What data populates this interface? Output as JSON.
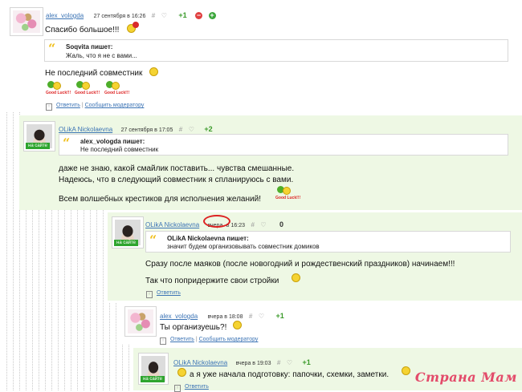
{
  "comments": [
    {
      "user": "alex_vologda",
      "date": "27 сентября в 16:26",
      "hash": "#",
      "score": "+1",
      "minus": "−",
      "plus": "+",
      "text": "Спасибо большое!!!",
      "quote": {
        "name": "Soqvita пишет:",
        "text": "Жаль, что я не с вами..."
      },
      "text2": "Не последний совместник",
      "goodluck": [
        "Good Luck!!!",
        "Good Luck!!!",
        "Good Luck!!!"
      ],
      "reply": "Ответить",
      "sep": "|",
      "report": "Сообщить модератору"
    },
    {
      "user": "OLikA Nickolaevna",
      "online": "на сайте",
      "date": "27 сентября в 17:05",
      "hash": "#",
      "score": "+2",
      "quote": {
        "name": "alex_vologda пишет:",
        "text": "Не последний совместник"
      },
      "lines": [
        "даже не знаю, какой смайлик поставить... чувства смешанные.",
        "Надеюсь, что в следующий совместник я спланируюсь с вами.",
        "Всем волшебных крестиков для исполнения желаний!"
      ],
      "goodluck": "Good Luck!!!"
    },
    {
      "user": "OLikA Nickolaevna",
      "online": "на сайте",
      "date_day": "вчера",
      "date_time": "в 16:23",
      "hash": "#",
      "score": "0",
      "quote": {
        "name": "OLikA Nickolaevna пишет:",
        "text": "значит будем организовывать совместник домиков"
      },
      "lines": [
        "Сразу после маяков (после новогодний и рождественский праздников) начинаем!!!",
        "Так что попридержите свои стройки"
      ],
      "reply": "Ответить"
    },
    {
      "user": "alex_vologda",
      "date": "вчера в 18:08",
      "hash": "#",
      "score": "+1",
      "text": "Ты организуешь?!",
      "reply": "Ответить",
      "sep": "|",
      "report": "Сообщить модератору"
    },
    {
      "user": "OLikA Nickolaevna",
      "online": "на сайте",
      "date": "вчера в 19:03",
      "hash": "#",
      "score": "+1",
      "text": "а я уже начала подготовку: папочки, схемки, заметки.",
      "reply": "Ответить"
    }
  ],
  "watermark": "Страна Мам",
  "icons": {
    "heart": "heart-icon",
    "quote": "quote-icon",
    "reply_box": "reply-box-icon",
    "smiley": "smiley-icon"
  },
  "colors": {
    "link": "#3c74b5",
    "score_green": "#3a9a2a",
    "reply_bg": "#eef8e4",
    "online_badge": "#2fa52f",
    "watermark": "#e34b6a",
    "highlight": "#d22"
  }
}
